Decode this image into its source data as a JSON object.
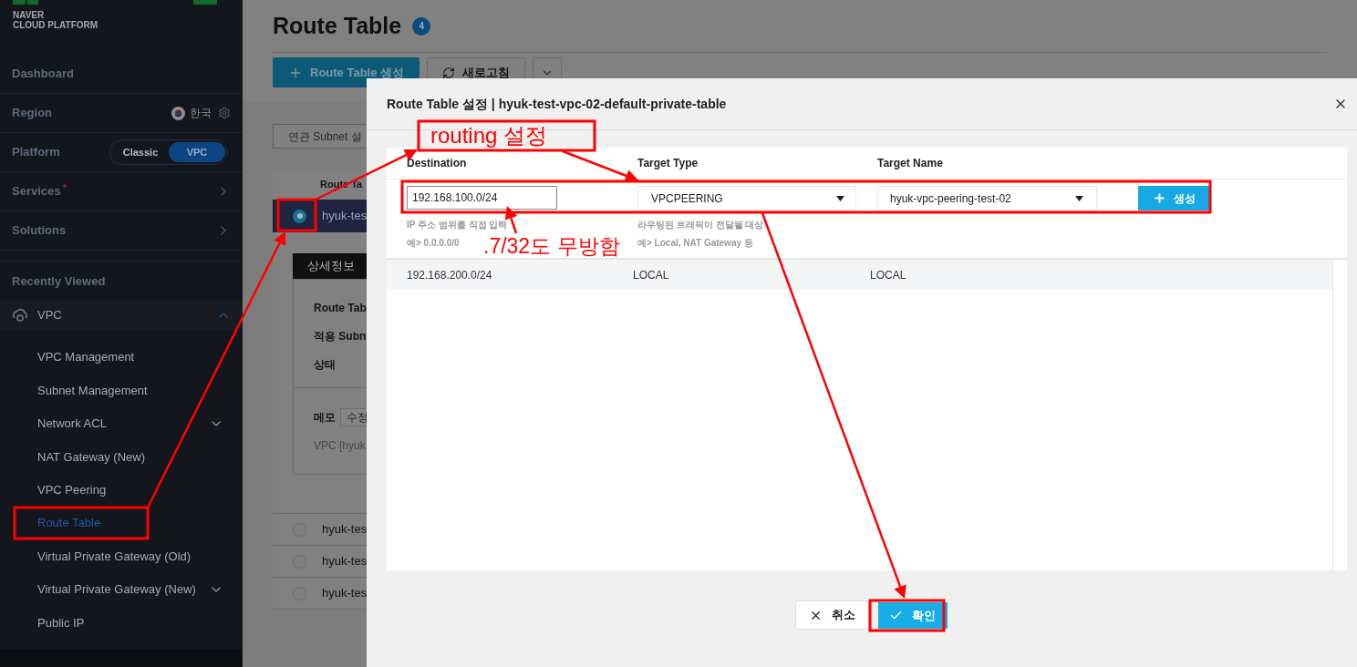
{
  "sidebar": {
    "logo": {
      "line_1": "NAVER",
      "line_2": "CLOUD PLATFORM"
    },
    "dashboard": "Dashboard",
    "region": {
      "label": "Region",
      "value": "한국"
    },
    "platform": {
      "label": "Platform",
      "options": [
        {
          "label": "Classic",
          "selected": false
        },
        {
          "label": "VPC",
          "selected": true
        }
      ]
    },
    "menus": [
      {
        "label": "Services",
        "badge_dot": true
      },
      {
        "label": "Solutions",
        "badge_dot": false
      }
    ],
    "recently_viewed": "Recently Viewed",
    "service": {
      "label": "VPC",
      "expanded": true,
      "items": [
        {
          "label": "VPC Management",
          "selected": false,
          "has_submenu": false
        },
        {
          "label": "Subnet Management",
          "selected": false,
          "has_submenu": false
        },
        {
          "label": "Network ACL",
          "selected": false,
          "has_submenu": true
        },
        {
          "label": "NAT Gateway (New)",
          "selected": false,
          "has_submenu": false
        },
        {
          "label": "VPC Peering",
          "selected": false,
          "has_submenu": false
        },
        {
          "label": "Route Table",
          "selected": true,
          "has_submenu": false
        },
        {
          "label": "Virtual Private Gateway (Old)",
          "selected": false,
          "has_submenu": false
        },
        {
          "label": "Virtual Private Gateway (New)",
          "selected": false,
          "has_submenu": true
        },
        {
          "label": "Public IP",
          "selected": false,
          "has_submenu": false
        }
      ]
    }
  },
  "page": {
    "title": "Route Table",
    "count": "4",
    "create_button": "Route Table 생성",
    "refresh_button": "새로고침",
    "subnet_button": "연관 Subnet 설",
    "table": {
      "column_1": "Route Ta",
      "rows": [
        {
          "name": "hyuk-tes",
          "selected": true
        },
        {
          "name": "hyuk-tes",
          "selected": false
        },
        {
          "name": "hyuk-tes",
          "selected": false
        },
        {
          "name": "hyuk-tes",
          "selected": false
        }
      ]
    },
    "details": {
      "tab": "상세정보",
      "fields": [
        "Route Tab",
        "적용 Subn",
        "상태"
      ],
      "memo_label": "메모",
      "memo_button": "수정",
      "memo_text": "VPC [hyuk"
    }
  },
  "modal": {
    "title": "Route Table 설정 | hyuk-test-vpc-02-default-private-table",
    "columns": [
      "Destination",
      "Target Type",
      "Target Name"
    ],
    "destination": {
      "value": "192.168.100.0/24",
      "hints": [
        "IP 주소 범위를 직접 입력",
        "예> 0.0.0.0/0"
      ]
    },
    "target_type": {
      "value": "VPCPEERING",
      "hints": [
        "라우팅된 트래픽이 전달될 대상",
        "예> Local, NAT Gateway 등"
      ]
    },
    "target_name": {
      "value": "hyuk-vpc-peering-test-02"
    },
    "add_button": "생성",
    "routes": [
      {
        "destination": "192.168.200.0/24",
        "target_type": "LOCAL",
        "target_name": "LOCAL"
      }
    ],
    "cancel_button": "취소",
    "confirm_button": "확인"
  },
  "annotations": [
    {
      "text": "routing 설정"
    },
    {
      "text": ".7/32도 무방함"
    }
  ]
}
